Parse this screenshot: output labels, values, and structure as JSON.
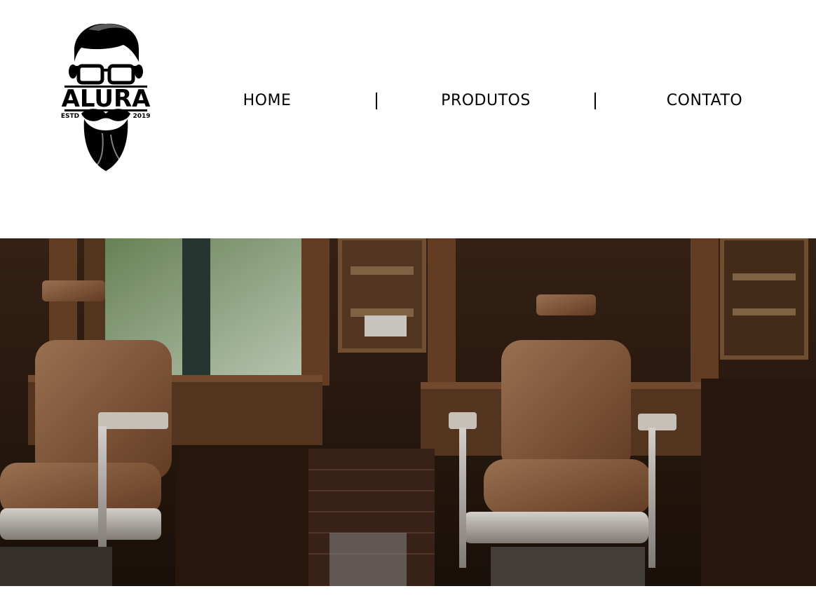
{
  "logo": {
    "brand": "ALURA",
    "left_tag": "ESTD",
    "right_tag": "2019"
  },
  "nav": {
    "items": [
      {
        "label": "HOME"
      },
      {
        "label": "PRODUTOS"
      },
      {
        "label": "CONTATO"
      }
    ]
  },
  "banner": {
    "subject": "barbershop interior with two brown leather barber chairs",
    "icon": "barbershop-photo"
  },
  "colors": {
    "background": "#ffffff",
    "text": "#000000",
    "wood_dark": "#2a1a10",
    "leather": "#8a5a3a"
  }
}
